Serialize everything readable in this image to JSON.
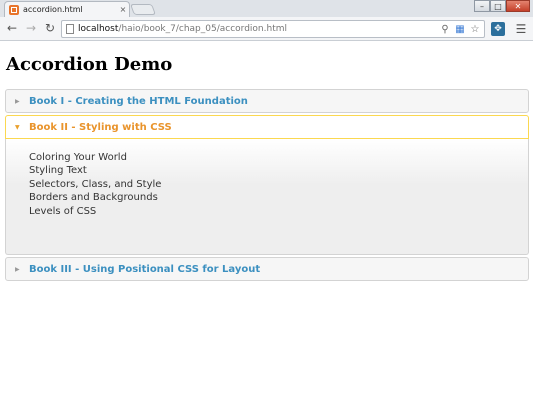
{
  "browser": {
    "tab_title": "accordion.html",
    "tab_close": "×",
    "url_host": "localhost",
    "url_path": "/haio/book_7/chap_05/accordion.html"
  },
  "page": {
    "title": "Accordion Demo"
  },
  "accordion": {
    "sections": [
      {
        "label": "Book I - Creating the HTML Foundation",
        "expanded": false
      },
      {
        "label": "Book II - Styling with CSS",
        "expanded": true,
        "items": [
          "Coloring Your World",
          "Styling Text",
          "Selectors, Class, and Style",
          "Borders and Backgrounds",
          "Levels of CSS"
        ]
      },
      {
        "label": "Book III - Using Positional CSS for Layout",
        "expanded": false
      }
    ]
  },
  "colors": {
    "header_link": "#3c90c0",
    "active_header": "#e9942c",
    "active_border": "#fbd850"
  },
  "icons": {
    "back": "arrow-left-icon",
    "forward": "arrow-right-icon",
    "reload": "reload-icon",
    "search": "search-icon",
    "star": "star-icon",
    "menu": "hamburger-menu-icon"
  }
}
